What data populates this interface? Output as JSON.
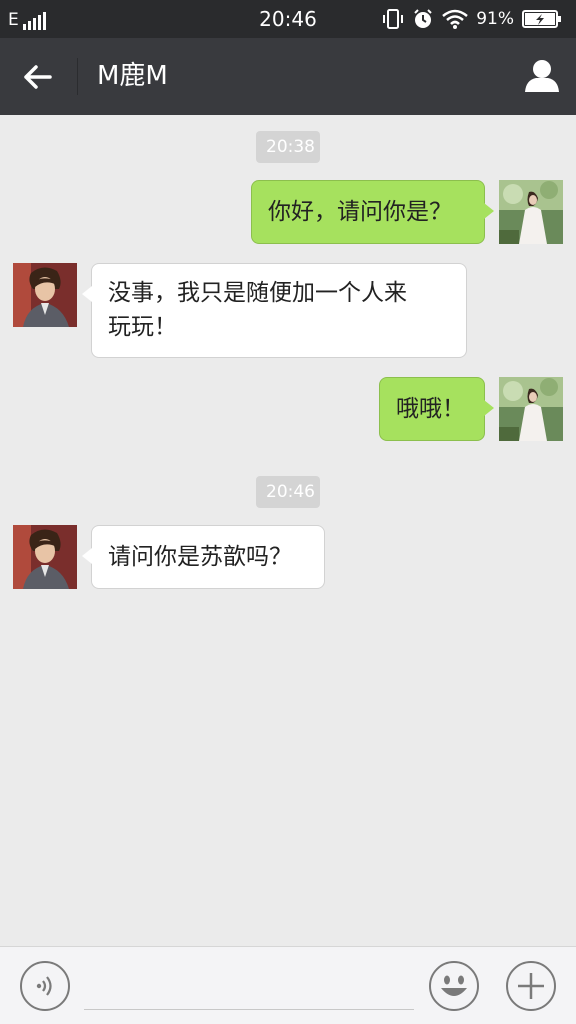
{
  "status_bar": {
    "network": "E",
    "time": "20:46",
    "battery_percent": "91%",
    "icons": [
      "signal-icon",
      "vibrate-icon",
      "alarm-icon",
      "wifi-icon",
      "battery-charging-icon"
    ]
  },
  "header": {
    "title": "M鹿M",
    "back_icon": "arrow-left-icon",
    "profile_icon": "person-icon",
    "background": "#393a3e"
  },
  "messages": [
    {
      "type": "time",
      "text": "20:38"
    },
    {
      "type": "outgoing",
      "text": "你好，请问你是？"
    },
    {
      "type": "incoming",
      "text": "没事，我只是随便加一个人来玩玩！",
      "lines": [
        "没事，我只是随便加一个人来",
        "玩玩！"
      ]
    },
    {
      "type": "outgoing",
      "text": "哦哦！"
    },
    {
      "type": "time",
      "text": "20:46"
    },
    {
      "type": "incoming",
      "text": "请问你是苏歆吗？"
    }
  ],
  "input_bar": {
    "voice_icon": "voice-icon",
    "emoji_icon": "smile-icon",
    "more_icon": "plus-icon",
    "input_value": ""
  },
  "colors": {
    "outgoing_bubble": "#a6e15e",
    "incoming_bubble": "#ffffff",
    "chat_background": "#ebebeb"
  }
}
